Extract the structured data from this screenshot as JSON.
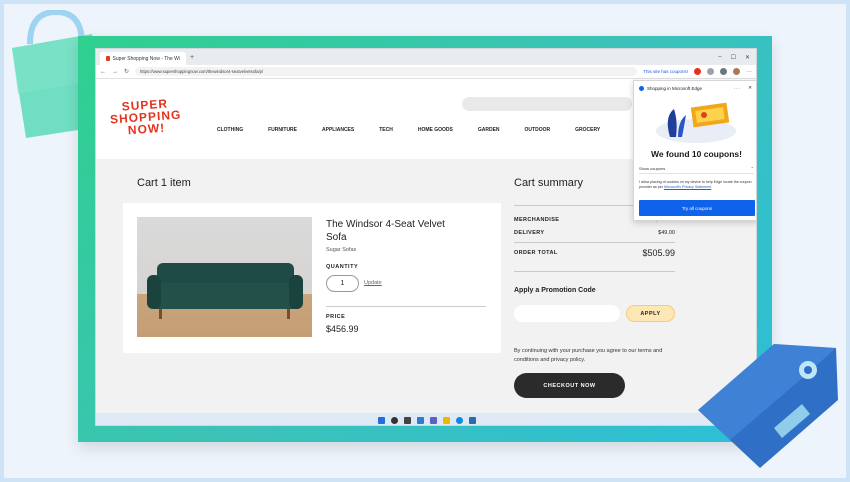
{
  "browser": {
    "tab_title": "Super Shopping Now - The Wi",
    "tab_new": "+",
    "url": "https://www.supershoppingnow.com/thewindsor4-seatvelvetsofa/p/",
    "coupon_note": "This site has coupons!",
    "win_minimize": "–",
    "win_maximize": "☐",
    "win_close": "✕"
  },
  "site": {
    "logo_lines": [
      "SUPER",
      "SHOPPING",
      "NOW!"
    ],
    "nav": [
      "CLOTHING",
      "FURNITURE",
      "APPLIANCES",
      "TECH",
      "HOME GOODS",
      "GARDEN",
      "OUTDOOR",
      "GROCERY"
    ]
  },
  "cart": {
    "title": "Cart 1 item",
    "product_name": "The Windsor 4-Seat Velvet Sofa",
    "seller": "Sugar Sofas",
    "quantity_label": "QUANTITY",
    "quantity": "1",
    "update_link": "Update",
    "price_label": "PRICE",
    "price": "$456.99"
  },
  "summary": {
    "title": "Cart summary",
    "merchandise_label": "MERCHANDISE",
    "merchandise_value": "$456.99",
    "delivery_label": "DELIVERY",
    "delivery_value": "$49.00",
    "total_label": "ORDER TOTAL",
    "total_value": "$505.99",
    "promo_title": "Apply a Promotion Code",
    "promo_placeholder": "",
    "apply_label": "APPLY",
    "legal": "By continuing with your purchase you agree to our terms and conditions and privacy policy.",
    "checkout_label": "CHECKOUT NOW"
  },
  "popup": {
    "header": "Shopping in Microsoft Edge",
    "menu": "···",
    "close": "✕",
    "found": "We found 10 coupons!",
    "show_coupons": "Show coupons",
    "show_chevron": "⌃",
    "consent": "I allow placing of cookies on my device to help Edge locate the coupon provider as per",
    "consent_link": "Microsoft's Privacy Statement",
    "try_label": "Try all coupons"
  },
  "colors": {
    "logo_red": "#e5321e",
    "popup_blue": "#1062ea",
    "checkout_dark": "#2b2b2b",
    "apply_yellow": "#fde7b5"
  }
}
